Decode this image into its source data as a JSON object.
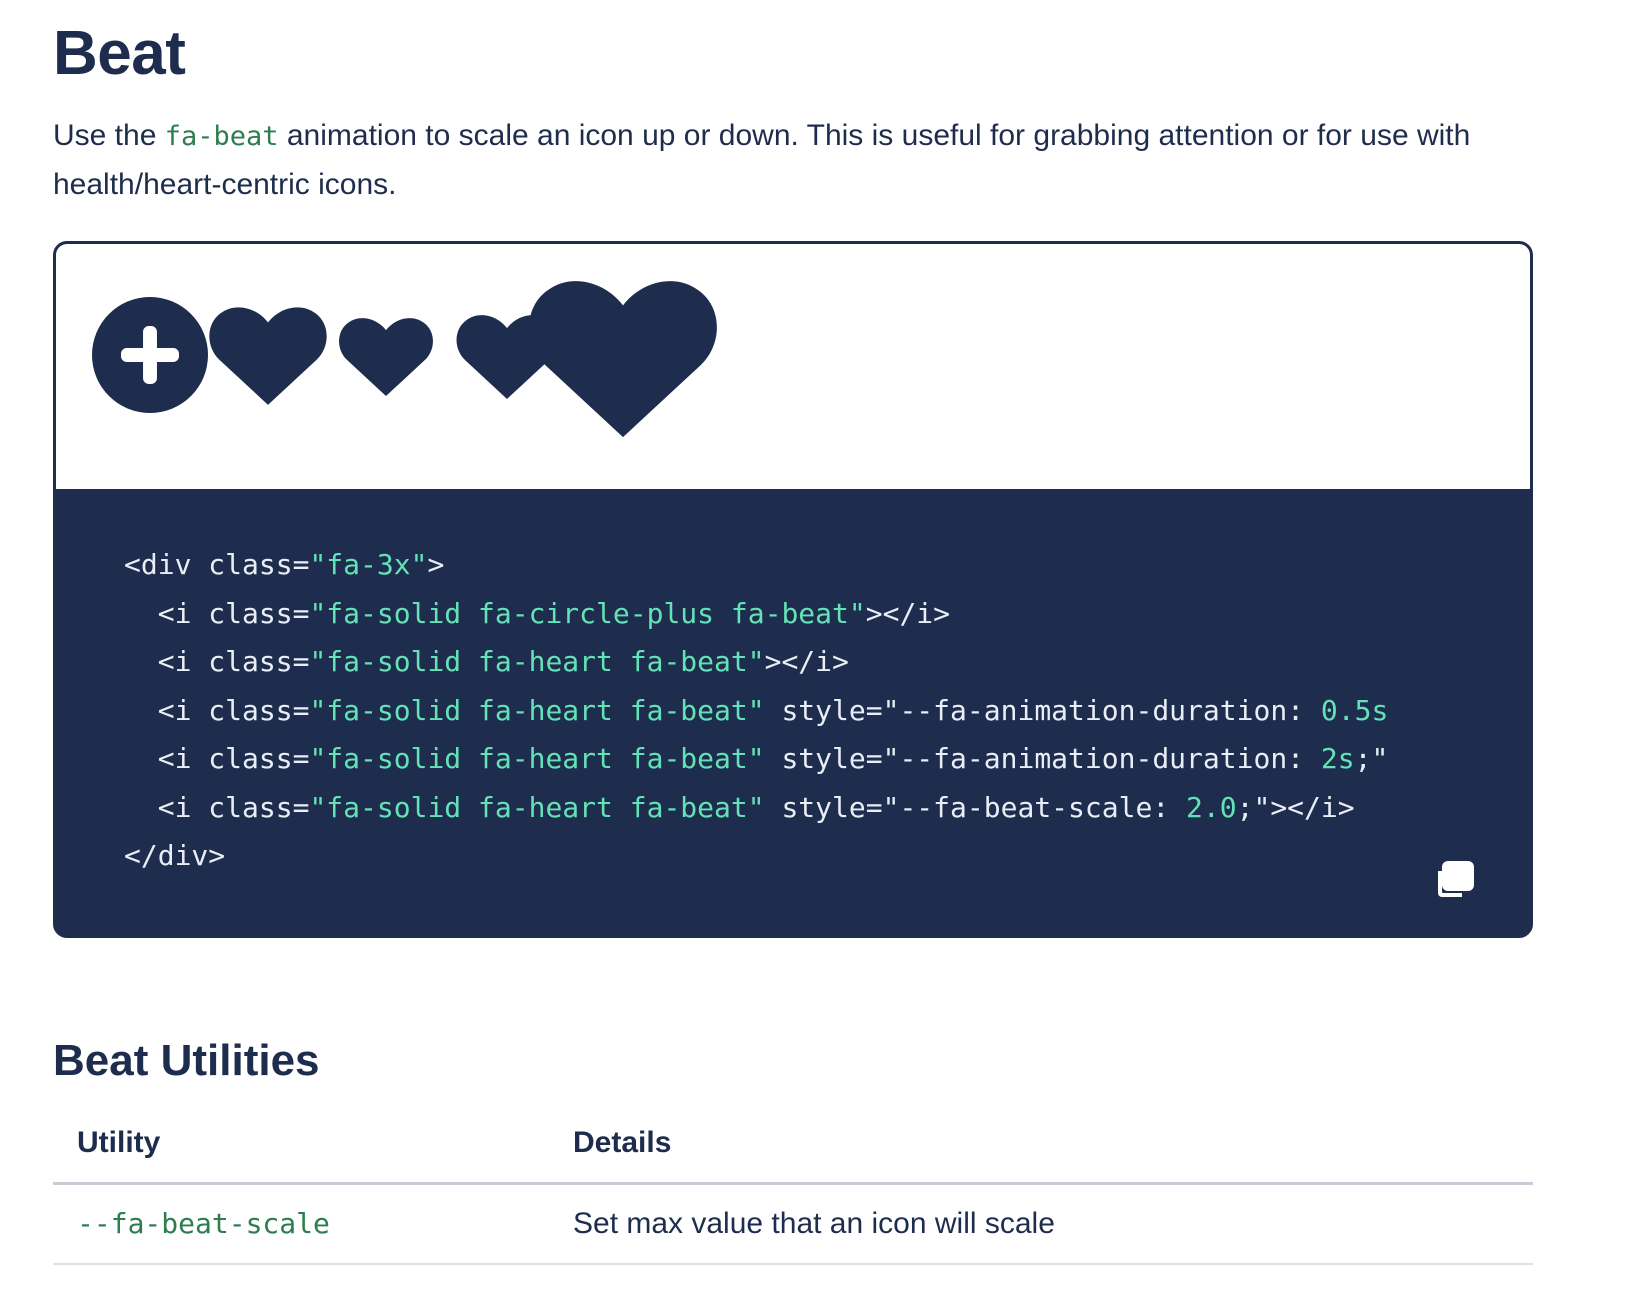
{
  "title": "Beat",
  "intro": {
    "before": "Use the ",
    "code": "fa-beat",
    "after": " animation to scale an icon up or down. This is useful for grabbing attention or for use with health/heart-centric icons."
  },
  "preview": {
    "icons": [
      "circle-plus-icon",
      "heart-icon",
      "heart-icon",
      "heart-icon",
      "heart-icon"
    ]
  },
  "code_lines": [
    [
      {
        "t": "t",
        "v": "<div class="
      },
      {
        "t": "s",
        "v": "\"fa-3x\""
      },
      {
        "t": "t",
        "v": ">"
      }
    ],
    [
      {
        "t": "t",
        "v": "  <i class="
      },
      {
        "t": "s",
        "v": "\"fa-solid fa-circle-plus fa-beat\""
      },
      {
        "t": "t",
        "v": "></i>"
      }
    ],
    [
      {
        "t": "t",
        "v": "  <i class="
      },
      {
        "t": "s",
        "v": "\"fa-solid fa-heart fa-beat\""
      },
      {
        "t": "t",
        "v": "></i>"
      }
    ],
    [
      {
        "t": "t",
        "v": "  <i class="
      },
      {
        "t": "s",
        "v": "\"fa-solid fa-heart fa-beat\""
      },
      {
        "t": "t",
        "v": " style=\"--fa-animation-duration: "
      },
      {
        "t": "s",
        "v": "0.5s"
      }
    ],
    [
      {
        "t": "t",
        "v": "  <i class="
      },
      {
        "t": "s",
        "v": "\"fa-solid fa-heart fa-beat\""
      },
      {
        "t": "t",
        "v": " style=\"--fa-animation-duration: "
      },
      {
        "t": "s",
        "v": "2s"
      },
      {
        "t": "t",
        "v": ";\""
      }
    ],
    [
      {
        "t": "t",
        "v": "  <i class="
      },
      {
        "t": "s",
        "v": "\"fa-solid fa-heart fa-beat\""
      },
      {
        "t": "t",
        "v": " style=\"--fa-beat-scale: "
      },
      {
        "t": "s",
        "v": "2.0"
      },
      {
        "t": "t",
        "v": ";\"></i>"
      }
    ],
    [
      {
        "t": "t",
        "v": "</div>"
      }
    ]
  ],
  "copy_icon": "copy-icon",
  "utilities_section": {
    "title": "Beat Utilities",
    "headers": [
      "Utility",
      "Details"
    ],
    "rows": [
      {
        "utility": "--fa-beat-scale",
        "details": "Set max value that an icon will scale"
      }
    ]
  },
  "colors": {
    "navy": "#1e2d4d",
    "code_string": "#63e2b7",
    "inline_code": "#2e7d4f"
  }
}
